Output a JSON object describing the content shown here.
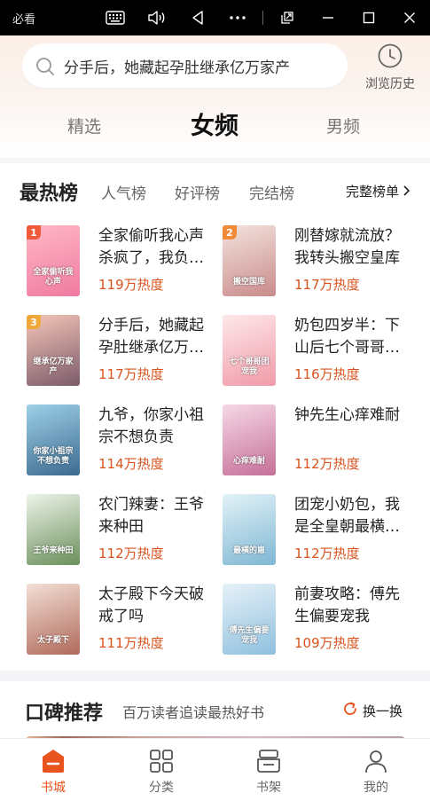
{
  "window": {
    "title": "必看"
  },
  "header": {
    "search_text": "分手后，她藏起孕肚继承亿万家产",
    "history_label": "浏览历史",
    "tabs": [
      {
        "label": "精选",
        "active": false
      },
      {
        "label": "女频",
        "active": true
      },
      {
        "label": "男频",
        "active": false
      }
    ]
  },
  "ranking": {
    "title": "最热榜",
    "tabs": [
      "人气榜",
      "好评榜",
      "完结榜"
    ],
    "more_label": "完整榜单",
    "books": [
      {
        "rank": "1",
        "title": "全家偷听我心声杀疯了，我负责吃奶",
        "heat": "119万热度",
        "cover_text": "全家偷听我心声",
        "colors": [
          "#ffb8c6",
          "#f07aa0"
        ],
        "badge_color": "#f05a3a"
      },
      {
        "rank": "2",
        "title": "刚替嫁就流放？我转头搬空皇库",
        "heat": "117万热度",
        "cover_text": "搬空国库",
        "colors": [
          "#f3e3dd",
          "#c98b8b"
        ],
        "badge_color": "#f08a3a"
      },
      {
        "rank": "3",
        "title": "分手后，她藏起孕肚继承亿万家产",
        "heat": "117万热度",
        "cover_text": "继承亿万家产",
        "colors": [
          "#f5c6b8",
          "#7c5a6a"
        ],
        "badge_color": "#f0a83a"
      },
      {
        "rank": "",
        "title": "奶包四岁半：下山后七个哥哥团宠我",
        "heat": "116万热度",
        "cover_text": "七个哥哥团宠我",
        "colors": [
          "#fde8ea",
          "#f19aa8"
        ],
        "badge_color": ""
      },
      {
        "rank": "",
        "title": "九爷，你家小祖宗不想负责",
        "heat": "114万热度",
        "cover_text": "你家小祖宗不想负责",
        "colors": [
          "#9ed0e8",
          "#3b6a8f"
        ],
        "badge_color": ""
      },
      {
        "rank": "",
        "title": "钟先生心痒难耐",
        "heat": "112万热度",
        "cover_text": "心痒难耐",
        "colors": [
          "#f6d8e6",
          "#c56f98"
        ],
        "badge_color": ""
      },
      {
        "rank": "",
        "title": "农门辣妻：王爷来种田",
        "heat": "112万热度",
        "cover_text": "王爷来种田",
        "colors": [
          "#eef4ea",
          "#6a8f5a"
        ],
        "badge_color": ""
      },
      {
        "rank": "",
        "title": "团宠小奶包，我是全皇朝最横的崽",
        "heat": "112万热度",
        "cover_text": "最横的崽",
        "colors": [
          "#e2f2f7",
          "#7fb7d4"
        ],
        "badge_color": ""
      },
      {
        "rank": "",
        "title": "太子殿下今天破戒了吗",
        "heat": "111万热度",
        "cover_text": "太子殿下",
        "colors": [
          "#f3dfd6",
          "#b06a5a"
        ],
        "badge_color": ""
      },
      {
        "rank": "",
        "title": "前妻攻略：傅先生偏要宠我",
        "heat": "109万热度",
        "cover_text": "傅先生偏要宠我",
        "colors": [
          "#e6f1f8",
          "#8fc0de"
        ],
        "badge_color": ""
      }
    ]
  },
  "recommend": {
    "title": "口碑推荐",
    "subtitle": "百万读者追读最热好书",
    "refresh_label": "换一换"
  },
  "nav": {
    "items": [
      {
        "label": "书城",
        "active": true
      },
      {
        "label": "分类",
        "active": false
      },
      {
        "label": "书架",
        "active": false
      },
      {
        "label": "我的",
        "active": false
      }
    ]
  },
  "colors": {
    "accent": "#e8541d",
    "heat": "#d9531e"
  }
}
